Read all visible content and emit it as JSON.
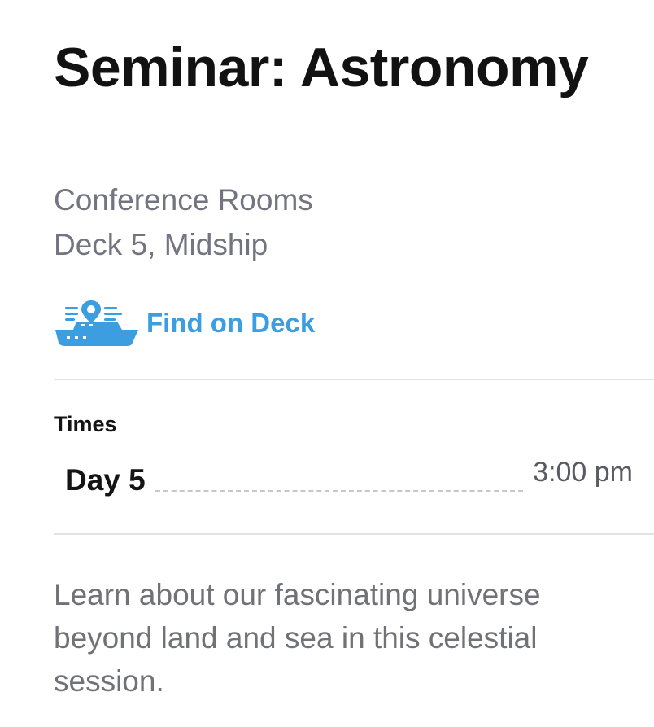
{
  "event": {
    "title": "Seminar: Astronomy",
    "location_line1": "Conference Rooms",
    "location_line2": "Deck 5, Midship"
  },
  "find_on_deck": {
    "label": "Find on Deck",
    "icon": "ship-location-icon",
    "color": "#3c9de0"
  },
  "times": {
    "heading": "Times",
    "rows": [
      {
        "day": "Day 5",
        "time": "3:00 pm"
      }
    ]
  },
  "description": "Learn about our fascinating universe beyond land and sea in this celestial session.",
  "colors": {
    "title": "#121212",
    "secondary_text": "#737480",
    "accent": "#3c9de0",
    "divider": "#e3e3e5"
  }
}
